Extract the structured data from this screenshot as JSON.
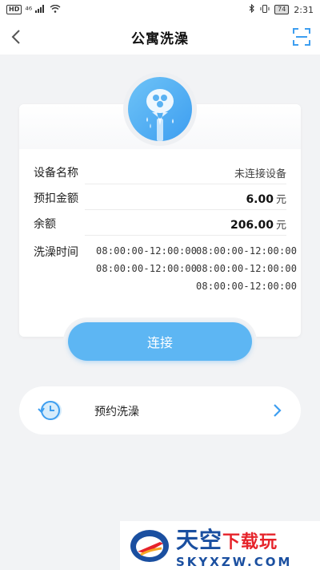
{
  "status_bar": {
    "hd": "HD",
    "signal": "⁴⁶",
    "battery": "74",
    "time": "2:31"
  },
  "header": {
    "title": "公寓洗澡"
  },
  "device": {
    "name_label": "设备名称",
    "name_value": "未连接设备",
    "deposit_label": "预扣金额",
    "deposit_value": "6.00",
    "deposit_unit": "元",
    "balance_label": "余额",
    "balance_value": "206.00",
    "balance_unit": "元",
    "time_label": "洗澡时间",
    "time_slots": [
      "08:00:00-12:00:00",
      "08:00:00-12:00:00",
      "08:00:00-12:00:00",
      "08:00:00-12:00:00",
      "08:00:00-12:00:00"
    ]
  },
  "connect_button": "连接",
  "reserve": {
    "label": "预约洗澡"
  },
  "watermark": {
    "title_big": "天空",
    "title_small": "下载玩",
    "url": "SKYXZW.COM"
  },
  "colors": {
    "accent": "#5db6f3",
    "background": "#f2f3f5"
  }
}
